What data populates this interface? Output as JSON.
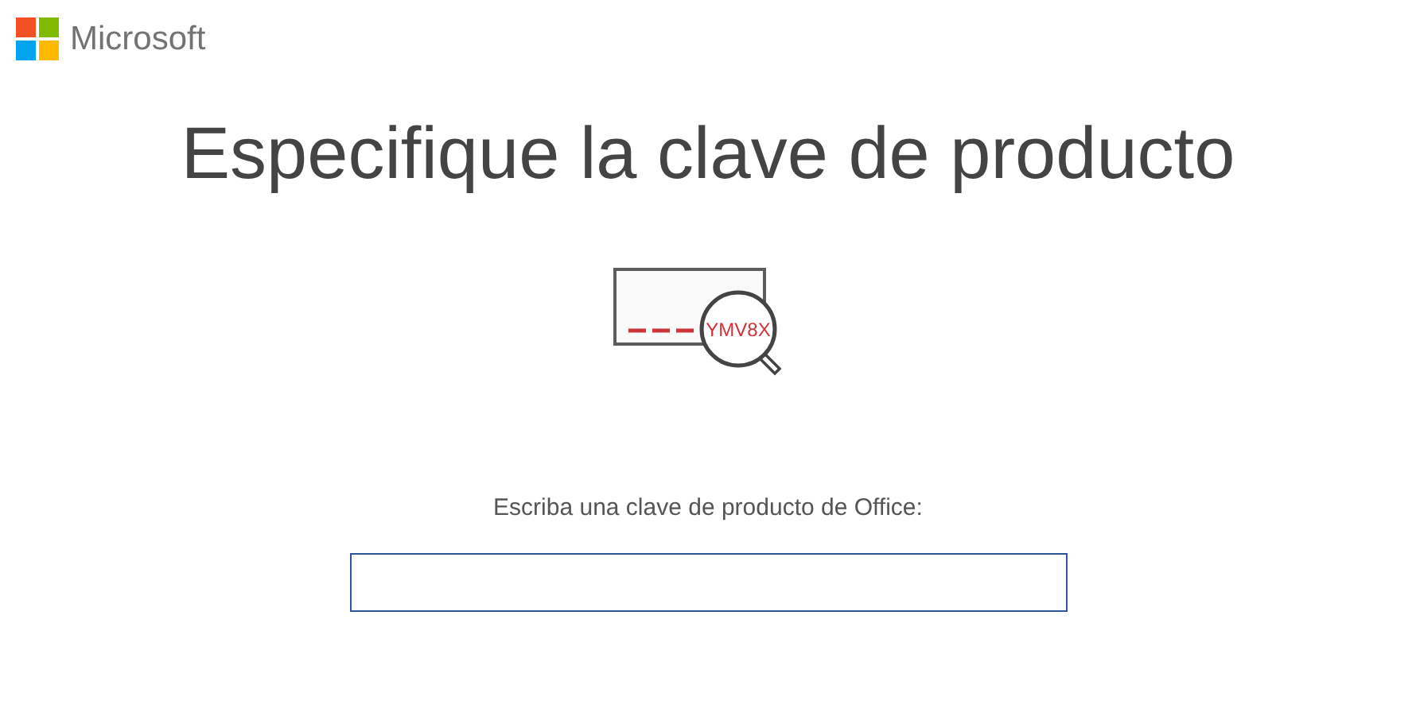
{
  "header": {
    "brand": "Microsoft"
  },
  "title": "Especifique la clave de producto",
  "illustration": {
    "key_fragment": "YMV8X"
  },
  "product_key": {
    "label": "Escriba una clave de producto de Office:"
  }
}
